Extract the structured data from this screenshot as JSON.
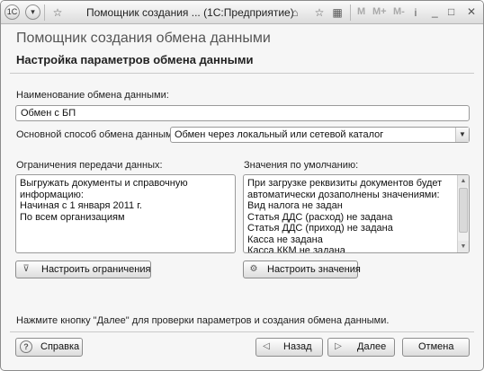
{
  "titlebar": {
    "app_icon": "1С",
    "title": "Помощник создания ... (1С:Предприятие)",
    "memory_buttons": [
      "M",
      "M+",
      "M-"
    ]
  },
  "header": {
    "title": "Помощник создания обмена данными",
    "subtitle": "Настройка параметров обмена данными"
  },
  "exchange_name": {
    "label": "Наименование обмена данными:",
    "value": "Обмен с БП"
  },
  "exchange_method": {
    "label": "Основной способ обмена данными:",
    "selected": "Обмен через локальный или сетевой каталог"
  },
  "restrictions": {
    "label": "Ограничения передачи данных:",
    "lines": [
      "Выгружать документы и справочную",
      "информацию:",
      "Начиная с 1 января 2011 г.",
      "По всем организациям"
    ],
    "button_label": "Настроить ограничения"
  },
  "defaults": {
    "label": "Значения по умолчанию:",
    "lines": [
      "При загрузке реквизиты документов будет",
      "автоматически дозаполнены значениями:",
      "Вид налога не задан",
      "Статья ДДС (расход) не задана",
      "Статья ДДС (приход) не задана",
      "Касса не задана",
      "Касса ККМ не задана"
    ],
    "button_label": "Настроить значения"
  },
  "hint": "Нажмите кнопку \"Далее\" для проверки параметров и создания обмена данными.",
  "footer": {
    "help_label": "Справка",
    "back_label": "Назад",
    "next_label": "Далее",
    "cancel_label": "Отмена"
  }
}
